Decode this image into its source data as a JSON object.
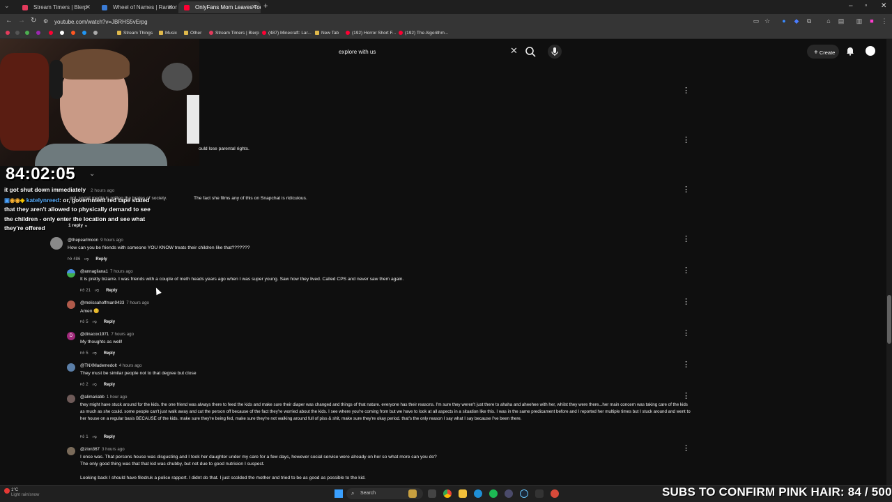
{
  "browser": {
    "tabs": [
      {
        "title": "Stream Timers | Blerp",
        "color": "#e33b5c",
        "active": false
      },
      {
        "title": "Wheel of Names | Random nam",
        "color": "#3a7bd5",
        "active": false
      },
      {
        "title": "OnlyFans Mom Leaves Toddler",
        "color": "#ff0033",
        "active": true
      }
    ],
    "url": "youtube.com/watch?v=JBRHS5vErpg",
    "bookmarks": [
      "Stream Things",
      "Music",
      "Other",
      "Stream Timers | Blerp",
      "(487) Minecraft: Lar...",
      "New Tab",
      "(192) Horror Short F...",
      "(192) The Algorithm..."
    ]
  },
  "header": {
    "search_query": "explore with us",
    "create_label": "Create"
  },
  "overlay": {
    "timer": "84:02:05",
    "chat_lines": [
      "it got shut down immediately",
      ": or, government red tape stated",
      "that they aren't allowed to physically demand to see",
      "the children - only enter the location and see what",
      "they're offered"
    ],
    "chat_name": "katelynreed",
    "subs_banner": "SUBS TO CONFIRM PINK HAIR: 84 / 500"
  },
  "partial": {
    "line1": "ould lose parental rights.",
    "line2": "The fact she films any of this on Snapchat is ridiculous.",
    "line2_prefix": "ppl, social media is rotting the brains of society.",
    "ghost_ago": "2 hours ago",
    "replies_toggle": "1 reply"
  },
  "comments": [
    {
      "user": "@thepearlmoon",
      "ago": "9 hours ago",
      "text": "How can you be friends with someone YOU KNOW treats their children like that???????",
      "likes": "486",
      "reply": "Reply"
    },
    {
      "user": "@annagilana1",
      "ago": "7 hours ago",
      "text": "It is pretty bizarre. I was friends with a couple of meth heads years ago when I was super young. Saw how they lived. Called CPS and never saw them again.",
      "likes": "21",
      "reply": "Reply"
    },
    {
      "user": "@melissahoffman9433",
      "ago": "7 hours ago",
      "text": "Amen 😊",
      "likes": "5",
      "reply": "Reply"
    },
    {
      "user": "@dinacox1971",
      "ago": "7 hours ago",
      "text": "My thoughts as well!",
      "likes": "5",
      "reply": "Reply"
    },
    {
      "user": "@TNXMademedolt",
      "ago": "4 hours ago",
      "text": "They must be similar people not to that degree but close",
      "likes": "2",
      "reply": "Reply"
    },
    {
      "user": "@alimariabb",
      "ago": "1 hour ago",
      "text": "they might have stuck around for the kids. the one friend was always there to feed the kids and make sure their diaper was changed and things of that nature. everyone has their reasons. I'm sure they weren't just there to ahaha and aheehee with her, whilst they were there...her main concern was taking care of the kids as much as she could. some people can't just walk away and cut the person off because of the fact they're worried about the kids. I see where you're coming from but we have to look at all aspects in a situation like this. I was in the same predicament before and I reported her multiple times but I stuck around and went to her house on a regular basis BECAUSE of the kids. make sure they're being fed, make sure they're not walking around full of piss & shit, make sure they're okay period. that's the only reason I say what I say because I've been there.",
      "likes": "1",
      "reply": "Reply"
    },
    {
      "user": "@zion367",
      "ago": "3 hours ago",
      "text": "I once was. That persons house was disgusting and I took her daughter under my care for a few days, however social service were already on her so what more can you do?",
      "text2": "The only good thing was that that kid was chubby, but not due to good nutricion I suspect.",
      "text3": "Looking back I should have filedruk a police rapport. I didnt do that. I just scolded the mother and tried to be as good as possible to the kid."
    }
  ],
  "taskbar": {
    "search_label": "Search",
    "weather_temp": "1°C",
    "weather_desc": "Light rain/snow"
  }
}
